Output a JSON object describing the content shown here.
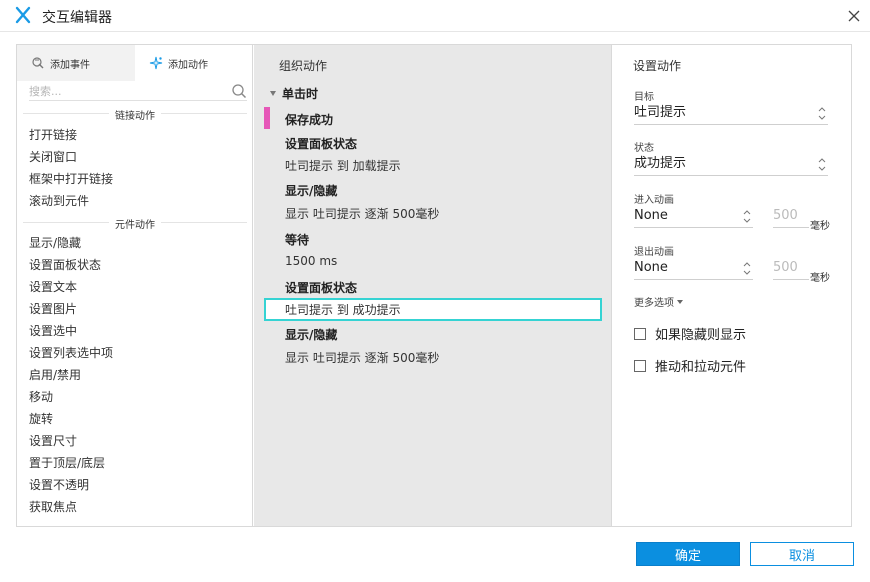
{
  "window": {
    "title": "交互编辑器"
  },
  "left": {
    "tab_events": "添加事件",
    "tab_actions": "添加动作",
    "search_placeholder": "搜索...",
    "section_links": "链接动作",
    "link_items": [
      "打开链接",
      "关闭窗口",
      "框架中打开链接",
      "滚动到元件"
    ],
    "section_widgets": "元件动作",
    "widget_items": [
      "显示/隐藏",
      "设置面板状态",
      "设置文本",
      "设置图片",
      "设置选中",
      "设置列表选中项",
      "启用/禁用",
      "移动",
      "旋转",
      "设置尺寸",
      "置于顶层/底层",
      "设置不透明",
      "获取焦点"
    ]
  },
  "middle": {
    "title": "组织动作",
    "event": "单击时",
    "case_name": "保存成功",
    "actions": [
      {
        "name": "设置面板状态",
        "detail": "吐司提示 到 加载提示"
      },
      {
        "name": "显示/隐藏",
        "detail": "显示 吐司提示 逐渐 500毫秒"
      },
      {
        "name": "等待",
        "detail": "1500 ms"
      },
      {
        "name": "设置面板状态",
        "detail": "吐司提示 到 成功提示"
      },
      {
        "name": "显示/隐藏",
        "detail": "显示 吐司提示 逐渐 500毫秒"
      }
    ]
  },
  "right": {
    "title": "设置动作",
    "target_label": "目标",
    "target_value": "吐司提示",
    "state_label": "状态",
    "state_value": "成功提示",
    "enter_anim_label": "进入动画",
    "enter_anim_value": "None",
    "enter_duration": "500",
    "exit_anim_label": "退出动画",
    "exit_anim_value": "None",
    "exit_duration": "500",
    "unit": "毫秒",
    "more_options": "更多选项",
    "check_show_if_hidden": "如果隐藏则显示",
    "check_push_pull": "推动和拉动元件"
  },
  "footer": {
    "ok": "确定",
    "cancel": "取消"
  },
  "colors": {
    "accent": "#0b8fe0",
    "case_marker": "#e657b8",
    "selection": "#35d3d3"
  }
}
